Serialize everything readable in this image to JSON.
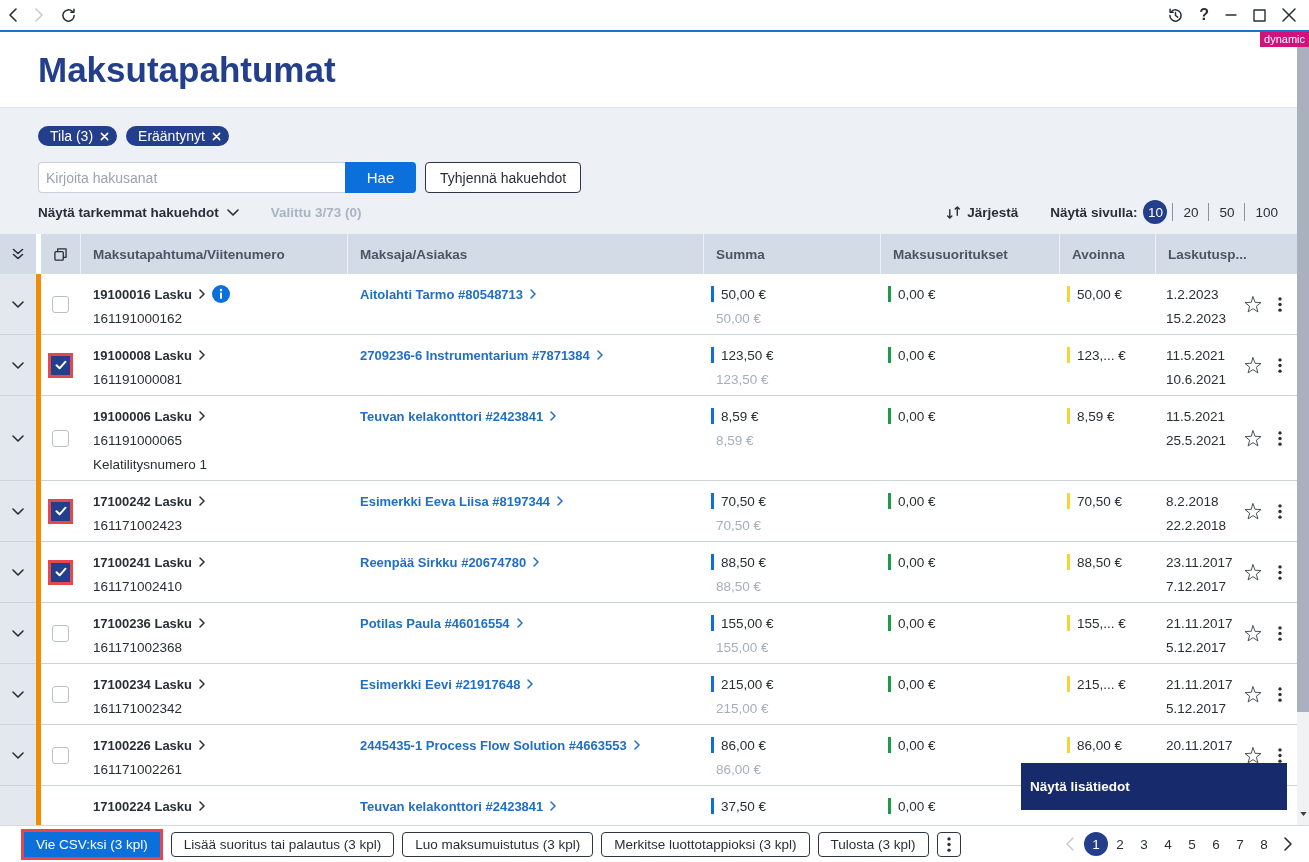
{
  "titlebar": {
    "back_disabled": false,
    "forward_disabled": true,
    "help": "?"
  },
  "badge": "dynamic",
  "title": "Maksutapahtumat",
  "filters": {
    "chips": [
      {
        "label": "Tila (3)"
      },
      {
        "label": "Erääntynyt"
      }
    ],
    "search": {
      "placeholder": "Kirjoita hakusanat",
      "button": "Hae"
    },
    "clear_button": "Tyhjennä hakuehdot",
    "advanced_toggle": {
      "label": "Näytä tarkemmat hakuehdot",
      "expanded": false
    },
    "selection_summary": "Valittu 3/73 (0)",
    "sort": "Järjestä",
    "page_size": {
      "label": "Näytä sivulla:",
      "options": [
        {
          "label": "10",
          "selected": true
        },
        {
          "label": "20",
          "selected": false
        },
        {
          "label": "50",
          "selected": false
        },
        {
          "label": "100",
          "selected": false
        }
      ]
    }
  },
  "table": {
    "columns": [
      "Maksutapahtuma/Viitenumero",
      "Maksaja/Asiakas",
      "Summa",
      "Maksusuoritukset",
      "Avoinna",
      "Laskutusp..."
    ],
    "rows": [
      {
        "expanded": false,
        "overdue": true,
        "checked": false,
        "invoice": "19100016 Lasku",
        "info": true,
        "reference": "161191000162",
        "customer": "Aitolahti Tarmo #80548713",
        "amount": "50,00 €",
        "amount_secondary": "50,00 €",
        "paid": "0,00 €",
        "open": "50,00 €",
        "dates": [
          "1.2.2023",
          "15.2.2023"
        ],
        "favorite": false
      },
      {
        "expanded": false,
        "overdue": true,
        "checked": true,
        "invoice": "19100008 Lasku",
        "info": false,
        "reference": "161191000081",
        "customer": "2709236-6 Instrumentarium #7871384",
        "amount": "123,50 €",
        "amount_secondary": "123,50 €",
        "paid": "0,00 €",
        "open": "123,... €",
        "dates": [
          "11.5.2021",
          "10.6.2021"
        ],
        "favorite": false
      },
      {
        "expanded": false,
        "overdue": true,
        "checked": false,
        "invoice": "19100006 Lasku",
        "info": false,
        "reference": "161191000065",
        "note": "Kelatilitysnumero 1",
        "customer": "Teuvan kelakonttori #2423841",
        "amount": "8,59 €",
        "amount_secondary": "8,59 €",
        "paid": "0,00 €",
        "open": "8,59 €",
        "dates": [
          "11.5.2021",
          "25.5.2021"
        ],
        "favorite": false
      },
      {
        "expanded": false,
        "overdue": true,
        "checked": true,
        "invoice": "17100242 Lasku",
        "info": false,
        "reference": "161171002423",
        "customer": "Esimerkki Eeva Liisa #8197344",
        "amount": "70,50 €",
        "amount_secondary": "70,50 €",
        "paid": "0,00 €",
        "open": "70,50 €",
        "dates": [
          "8.2.2018",
          "22.2.2018"
        ],
        "favorite": false
      },
      {
        "expanded": false,
        "overdue": true,
        "checked": true,
        "invoice": "17100241 Lasku",
        "info": false,
        "reference": "161171002410",
        "customer": "Reenpää Sirkku #20674780",
        "amount": "88,50 €",
        "amount_secondary": "88,50 €",
        "paid": "0,00 €",
        "open": "88,50 €",
        "dates": [
          "23.11.2017",
          "7.12.2017"
        ],
        "favorite": false
      },
      {
        "expanded": false,
        "overdue": true,
        "checked": false,
        "invoice": "17100236 Lasku",
        "info": false,
        "reference": "161171002368",
        "customer": "Potilas Paula #46016554",
        "amount": "155,00 €",
        "amount_secondary": "155,00 €",
        "paid": "0,00 €",
        "open": "155,... €",
        "dates": [
          "21.11.2017",
          "5.12.2017"
        ],
        "favorite": false
      },
      {
        "expanded": false,
        "overdue": true,
        "checked": false,
        "invoice": "17100234 Lasku",
        "info": false,
        "reference": "161171002342",
        "customer": "Esimerkki Eevi #21917648",
        "amount": "215,00 €",
        "amount_secondary": "215,00 €",
        "paid": "0,00 €",
        "open": "215,... €",
        "dates": [
          "21.11.2017",
          "5.12.2017"
        ],
        "favorite": false
      },
      {
        "expanded": false,
        "overdue": true,
        "checked": false,
        "invoice": "17100226 Lasku",
        "info": false,
        "reference": "161171002261",
        "customer": "2445435-1 Process Flow Solution #4663553",
        "amount": "86,00 €",
        "amount_secondary": "86,00 €",
        "paid": "0,00 €",
        "open": "86,00 €",
        "dates": [
          "20.11.2017"
        ],
        "favorite": false
      },
      {
        "overdue": true,
        "invoice": "17100224 Lasku",
        "info": false,
        "customer": "Teuvan kelakonttori #2423841",
        "amount": "37,50 €",
        "paid": "0,00 €"
      }
    ]
  },
  "tooltip": "Näytä lisätiedot",
  "footer": {
    "actions": [
      {
        "kind": "primary",
        "label": "Vie CSV:ksi (3 kpl)",
        "highlighted": true
      },
      {
        "kind": "secondary",
        "label": "Lisää suoritus tai palautus (3 kpl)",
        "highlighted": false
      },
      {
        "kind": "secondary",
        "label": "Luo maksumuistutus (3 kpl)",
        "highlighted": false
      },
      {
        "kind": "secondary",
        "label": "Merkitse luottotappioksi (3 kpl)",
        "highlighted": false
      },
      {
        "kind": "secondary",
        "label": "Tulosta (3 kpl)",
        "highlighted": false
      },
      {
        "kind": "more",
        "highlighted": false
      }
    ],
    "pagination": {
      "prev_disabled": true,
      "next_disabled": false,
      "pages": [
        {
          "label": "1",
          "selected": true
        },
        {
          "label": "2",
          "selected": false
        },
        {
          "label": "3",
          "selected": false
        },
        {
          "label": "4",
          "selected": false
        },
        {
          "label": "5",
          "selected": false
        },
        {
          "label": "6",
          "selected": false
        },
        {
          "label": "7",
          "selected": false
        },
        {
          "label": "8",
          "selected": false
        }
      ]
    }
  }
}
